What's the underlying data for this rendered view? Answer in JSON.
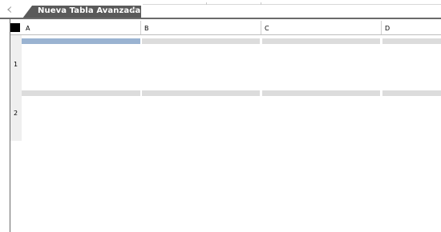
{
  "tabs": [
    {
      "label": "Nueva Tabla Avanzada",
      "close_glyph": "✕",
      "active": true
    }
  ],
  "grid": {
    "corner_label": "",
    "columns": [
      {
        "label": "A",
        "selected": true
      },
      {
        "label": "B",
        "selected": false
      },
      {
        "label": "C",
        "selected": false
      },
      {
        "label": "D",
        "selected": false
      }
    ],
    "rows": [
      {
        "label": "1"
      },
      {
        "label": "2"
      }
    ]
  },
  "colors": {
    "tab_background": "#5a5a5a",
    "selection": "#9ab3d1",
    "row_band": "#dcdcdc",
    "row_header": "#efefef"
  },
  "icons": {
    "tab_scroll_left": "chevron-left-icon",
    "tab_close": "close-icon",
    "select_all": "select-all-icon"
  }
}
